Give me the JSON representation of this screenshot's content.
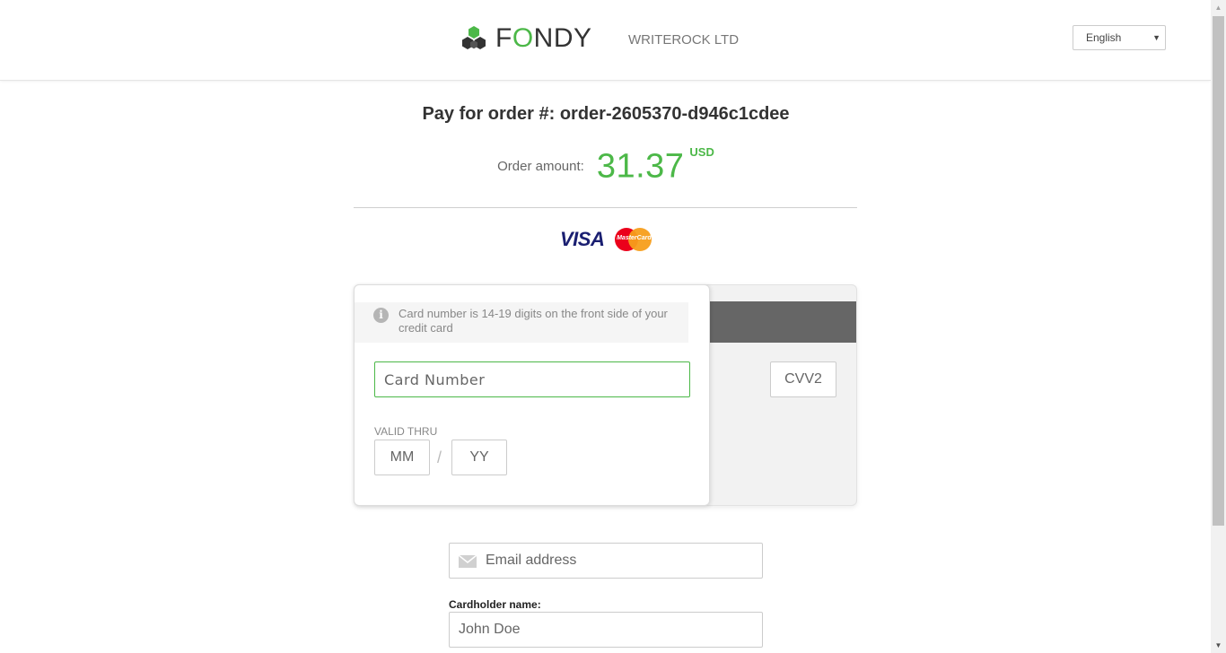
{
  "header": {
    "logo_text_before": "F",
    "logo_text_o": "O",
    "logo_text_after": "NDY",
    "merchant": "WRITEROCK LTD",
    "language": "English",
    "brand_color": "#4cb848"
  },
  "order": {
    "title": "Pay for order #: order-2605370-d946c1cdee",
    "amount_label": "Order amount:",
    "amount_value": "31.37",
    "currency": "USD"
  },
  "brands": {
    "visa": "VISA",
    "mastercard": "MasterCard"
  },
  "card_form": {
    "hint": "Card number is 14-19 digits on the front side of your credit card",
    "card_number_placeholder": "Card Number",
    "valid_thru_label": "VALID THRU",
    "month_placeholder": "MM",
    "year_placeholder": "YY",
    "separator": "/",
    "cvv_placeholder": "CVV2"
  },
  "contact": {
    "email_placeholder": "Email address",
    "cardholder_label": "Cardholder name:",
    "cardholder_placeholder": "John Doe"
  }
}
